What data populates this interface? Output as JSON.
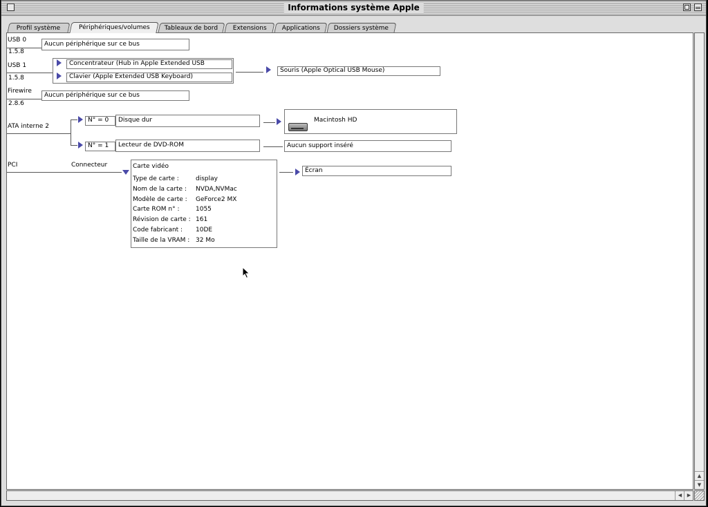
{
  "window": {
    "title": "Informations système Apple"
  },
  "tabs": [
    {
      "label": "Profil système",
      "active": false
    },
    {
      "label": "Périphériques/volumes",
      "active": true
    },
    {
      "label": "Tableaux de bord",
      "active": false
    },
    {
      "label": "Extensions",
      "active": false
    },
    {
      "label": "Applications",
      "active": false
    },
    {
      "label": "Dossiers système",
      "active": false
    }
  ],
  "usb0": {
    "name": "USB 0",
    "version": "1.5.8",
    "device": "Aucun périphérique sur ce bus"
  },
  "usb1": {
    "name": "USB 1",
    "version": "1.5.8",
    "hub": "Concentrateur (Hub in Apple Extended USB",
    "keyboard": "Clavier (Apple Extended USB Keyboard)",
    "mouse": "Souris (Apple Optical USB Mouse)"
  },
  "firewire": {
    "name": "Firewire",
    "version": "2.8.6",
    "device": "Aucun périphérique sur ce bus"
  },
  "ata": {
    "name": "ATA interne 2",
    "dev0": {
      "id": "N° = 0",
      "label": "Disque dur",
      "volume": "Macintosh HD"
    },
    "dev1": {
      "id": "N° = 1",
      "label": "Lecteur de DVD-ROM",
      "media": "Aucun support inséré"
    }
  },
  "pci": {
    "name": "PCI",
    "connector": "Connecteur",
    "card_title": "Carte vidéo",
    "rows": [
      {
        "k": "Type de carte :",
        "v": "display"
      },
      {
        "k": "Nom de la carte :",
        "v": "NVDA,NVMac"
      },
      {
        "k": "Modèle de carte :",
        "v": "GeForce2 MX"
      },
      {
        "k": "Carte ROM n° :",
        "v": "1055"
      },
      {
        "k": "Révision de carte :",
        "v": "161"
      },
      {
        "k": "Code fabricant :",
        "v": "10DE"
      },
      {
        "k": "Taille de la VRAM :",
        "v": "32 Mo"
      }
    ],
    "display": "Écran"
  }
}
